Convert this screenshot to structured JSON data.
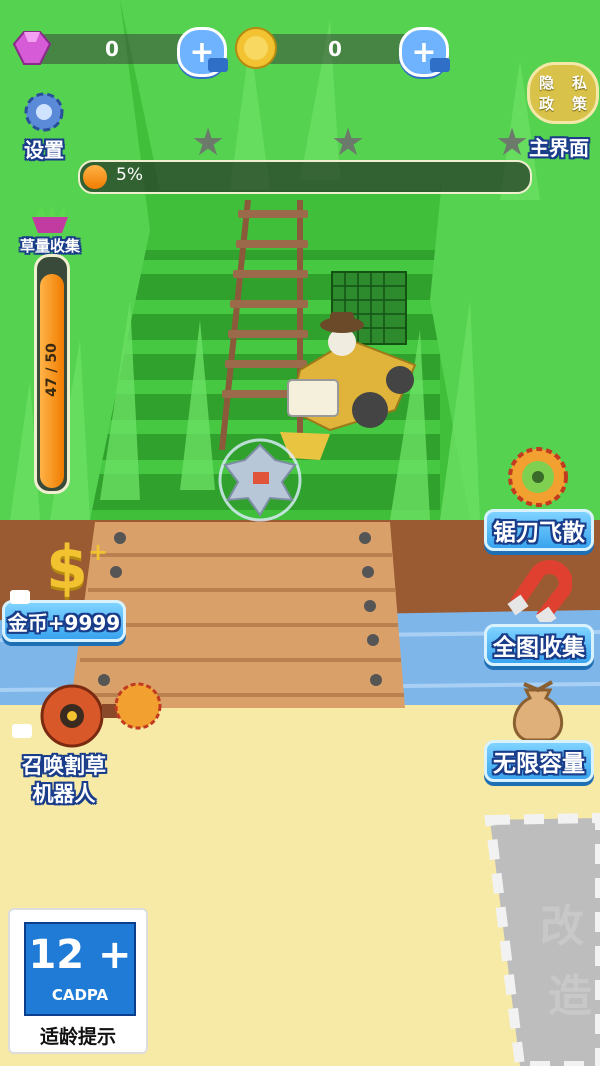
{
  "currency": {
    "gems": "0",
    "coins": "0"
  },
  "top": {
    "settings_label": "设置",
    "main_menu_label": "主界面",
    "privacy_chars": [
      "隐",
      "私",
      "政",
      "策"
    ],
    "progress_text": "5%",
    "progress_value": 0.05
  },
  "grass_collect": {
    "label": "草量收集",
    "count_text": "47 / 50",
    "fill_fraction": 0.94
  },
  "left_buttons": {
    "coins_label": "金币+9999",
    "robot_label_line1": "召唤割草",
    "robot_label_line2": "机器人"
  },
  "right_buttons": {
    "saw_label": "锯刀飞散",
    "collect_label": "全图收集",
    "capacity_label": "无限容量"
  },
  "age_rating": {
    "number": "12 +",
    "org": "CADPA",
    "tip": "适龄提示"
  },
  "build_zone": {
    "line1": "改",
    "line2": "造"
  },
  "colors": {
    "grass": "#3fbf3a",
    "button_blue": "#39a4ef",
    "progress_orange": "#f07c00",
    "sand": "#f7eaa6",
    "water": "#7fb6ea"
  },
  "icons": [
    "gem-icon",
    "coin-icon",
    "plus-icon",
    "video-icon",
    "gear-icon",
    "star-icon",
    "sawblade-icon",
    "magnet-icon",
    "sack-icon",
    "dollar-icon",
    "robot-icon",
    "basket-icon"
  ]
}
